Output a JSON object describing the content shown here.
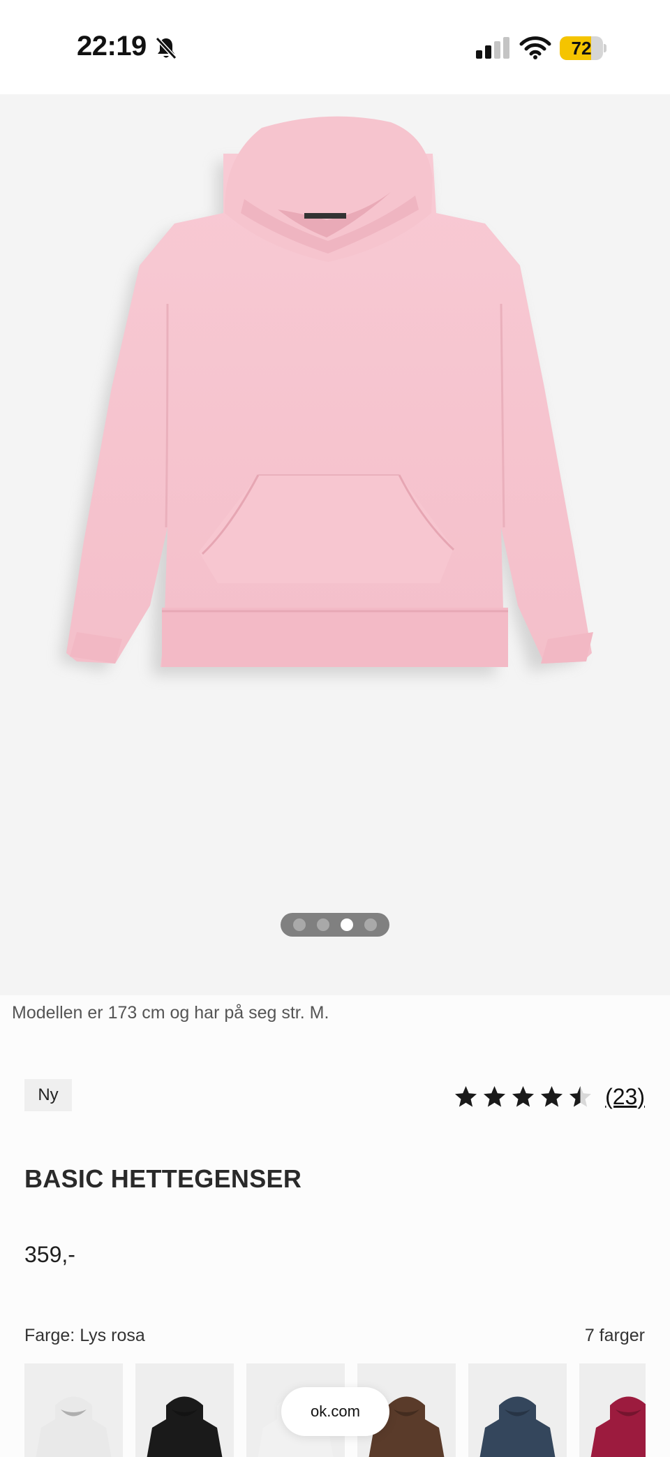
{
  "status_bar": {
    "time": "22:19",
    "battery_level": "72",
    "battery_percent": 72,
    "icons": [
      "bell-slash-icon",
      "cellular-signal-icon",
      "wifi-icon",
      "battery-icon"
    ]
  },
  "gallery": {
    "image": "pink-hoodie-product-photo",
    "slide_count": 4,
    "active_slide": 3
  },
  "product": {
    "model_info": "Modellen er 173 cm og har på seg str. M.",
    "badge": "Ny",
    "rating": 4.5,
    "rating_count": "(23)",
    "title": "BASIC HETTEGENSER",
    "price": "359,-"
  },
  "colors": {
    "label": "Farge: Lys rosa",
    "count_label": "7 farger",
    "swatches": [
      {
        "color": "#e9e9e9"
      },
      {
        "color": "#1a1a1a"
      },
      {
        "color": "#f1f1f1"
      },
      {
        "color": "#5a3b2a"
      },
      {
        "color": "#34465c"
      },
      {
        "color": "#9c1b3e"
      }
    ]
  },
  "browser": {
    "url": "ok.com"
  },
  "theme": {
    "hoodie_pink": "#f6c5cf",
    "accent_yellow": "#f5c400"
  }
}
